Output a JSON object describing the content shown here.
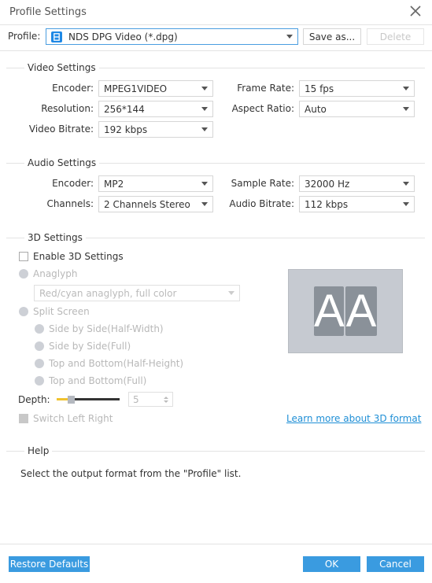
{
  "window": {
    "title": "Profile Settings",
    "close_icon": "close-icon"
  },
  "profile": {
    "label": "Profile:",
    "value": "NDS DPG Video (*.dpg)",
    "icon": "nds-device-icon",
    "save_as_label": "Save as...",
    "delete_label": "Delete"
  },
  "video": {
    "title": "Video Settings",
    "encoder": {
      "label": "Encoder:",
      "value": "MPEG1VIDEO"
    },
    "resolution": {
      "label": "Resolution:",
      "value": "256*144"
    },
    "bitrate": {
      "label": "Video Bitrate:",
      "value": "192 kbps"
    },
    "frame_rate": {
      "label": "Frame Rate:",
      "value": "15 fps"
    },
    "aspect_ratio": {
      "label": "Aspect Ratio:",
      "value": "Auto"
    }
  },
  "audio": {
    "title": "Audio Settings",
    "encoder": {
      "label": "Encoder:",
      "value": "MP2"
    },
    "channels": {
      "label": "Channels:",
      "value": "2 Channels Stereo"
    },
    "sample_rate": {
      "label": "Sample Rate:",
      "value": "32000 Hz"
    },
    "bitrate": {
      "label": "Audio Bitrate:",
      "value": "112 kbps"
    }
  },
  "three_d": {
    "title": "3D Settings",
    "enable_label": "Enable 3D Settings",
    "enabled": false,
    "anaglyph_label": "Anaglyph",
    "anaglyph_value": "Red/cyan anaglyph, full color",
    "split_screen_label": "Split Screen",
    "split_options": [
      "Side by Side(Half-Width)",
      "Side by Side(Full)",
      "Top and Bottom(Half-Height)",
      "Top and Bottom(Full)"
    ],
    "depth_label": "Depth:",
    "depth_value": "5",
    "depth_fraction": 0.2,
    "switch_label": "Switch Left Right",
    "preview_text_left": "A",
    "preview_text_right": "A",
    "learn_more": "Learn more about 3D format",
    "accent_color": "#f0c22e"
  },
  "help": {
    "title": "Help",
    "text": "Select the output format from the \"Profile\" list."
  },
  "footer": {
    "restore_label": "Restore Defaults",
    "ok_label": "OK",
    "cancel_label": "Cancel",
    "button_color": "#3a9be0"
  }
}
